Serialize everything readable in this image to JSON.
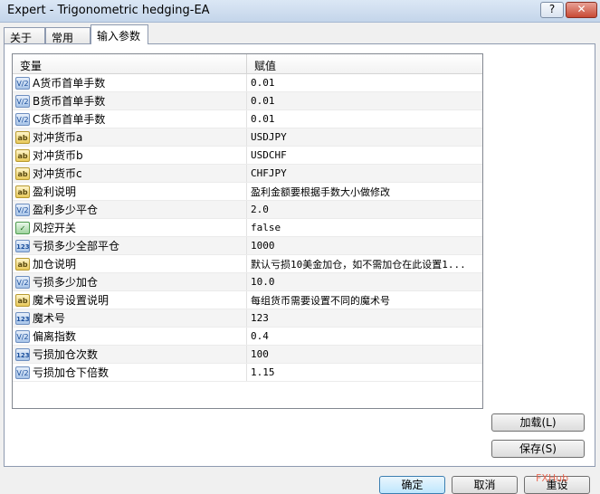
{
  "window": {
    "title": "Expert - Trigonometric hedging-EA",
    "help_label": "?",
    "close_label": "✕"
  },
  "tabs": [
    {
      "label": "关于"
    },
    {
      "label": "常用"
    },
    {
      "label": "输入参数"
    }
  ],
  "grid": {
    "col_variable": "变量",
    "col_value": "赋值",
    "rows": [
      {
        "type": "float",
        "icon": "V/2",
        "name": "A货币首单手数",
        "value": "0.01"
      },
      {
        "type": "float",
        "icon": "V/2",
        "name": "B货币首单手数",
        "value": "0.01"
      },
      {
        "type": "float",
        "icon": "V/2",
        "name": "C货币首单手数",
        "value": "0.01"
      },
      {
        "type": "string",
        "icon": "ab",
        "name": "对冲货币a",
        "value": "USDJPY"
      },
      {
        "type": "string",
        "icon": "ab",
        "name": "对冲货币b",
        "value": "USDCHF"
      },
      {
        "type": "string",
        "icon": "ab",
        "name": "对冲货币c",
        "value": "CHFJPY"
      },
      {
        "type": "string",
        "icon": "ab",
        "name": "盈利说明",
        "value": "盈利金额要根据手数大小做修改"
      },
      {
        "type": "float",
        "icon": "V/2",
        "name": "盈利多少平仓",
        "value": "2.0"
      },
      {
        "type": "bool",
        "icon": "✓",
        "name": "风控开关",
        "value": "false"
      },
      {
        "type": "int",
        "icon": "123",
        "name": "亏损多少全部平仓",
        "value": "1000"
      },
      {
        "type": "string",
        "icon": "ab",
        "name": "加仓说明",
        "value": "默认亏损10美金加仓，如不需加仓在此设置1..."
      },
      {
        "type": "float",
        "icon": "V/2",
        "name": "亏损多少加仓",
        "value": "10.0"
      },
      {
        "type": "string",
        "icon": "ab",
        "name": "魔术号设置说明",
        "value": "每组货币需要设置不同的魔术号"
      },
      {
        "type": "int",
        "icon": "123",
        "name": "魔术号",
        "value": "123"
      },
      {
        "type": "float",
        "icon": "V/2",
        "name": "偏离指数",
        "value": "0.4"
      },
      {
        "type": "int",
        "icon": "123",
        "name": "亏损加仓次数",
        "value": "100"
      },
      {
        "type": "float",
        "icon": "V/2",
        "name": "亏损加仓下倍数",
        "value": "1.15"
      }
    ]
  },
  "buttons": {
    "load": "加载(L)",
    "save": "保存(S)",
    "ok": "确定",
    "cancel": "取消",
    "reset": "重设"
  },
  "watermark": "FXHub"
}
